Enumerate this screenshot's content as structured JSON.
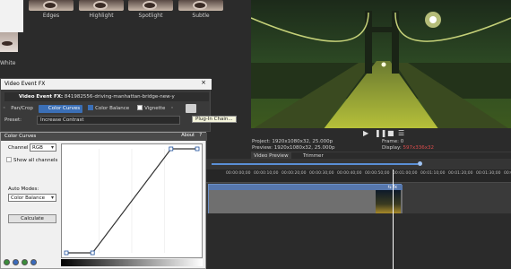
{
  "thumbnails": [
    {
      "label": "Edges"
    },
    {
      "label": "Highlight"
    },
    {
      "label": "Spotlight"
    },
    {
      "label": "Subtle"
    }
  ],
  "left_thumb_label": "White",
  "video_event_fx": {
    "title": "Video Event FX",
    "close": "×",
    "name_label": "Video Event FX:",
    "clip_name": "841982556-driving-manhattan-bridge-new-y",
    "chain": [
      {
        "label": "Pan/Crop",
        "checked": false,
        "active": false
      },
      {
        "label": "Color Curves",
        "checked": true,
        "active": true
      },
      {
        "label": "Color Balance",
        "checked": true,
        "active": false
      },
      {
        "label": "Vignette",
        "checked": false,
        "active": false
      }
    ],
    "preset_label": "Preset:",
    "preset_value": "Increase Contrast",
    "plugin_tooltip": "Plug-In Chain..."
  },
  "color_curves": {
    "title": "Color Curves",
    "about": "About",
    "help": "?",
    "channel_label": "Channel",
    "channel_value": "RGB",
    "show_all_label": "Show all channels",
    "auto_modes_label": "Auto Modes:",
    "auto_modes_value": "Color Balance",
    "calculate": "Calculate",
    "curve_points": [
      [
        0.0,
        0.0
      ],
      [
        0.2,
        0.0
      ],
      [
        0.8,
        1.0
      ],
      [
        1.0,
        1.0
      ]
    ]
  },
  "preview": {
    "properties": {
      "project_label": "Project:",
      "project_value": "1920x1080x32, 25.000p",
      "preview_label": "Preview:",
      "preview_value": "1920x1080x32, 25.000p",
      "frame_label": "Frame:",
      "frame_value": "0",
      "display_label": "Display:",
      "display_value": "597x336x32"
    },
    "tabs": [
      "Video Preview",
      "Trimmer"
    ]
  },
  "timeline": {
    "ticks": [
      "00:00:00;00",
      "00:00:10;00",
      "00:00:20;00",
      "00:00:30;00",
      "00:00:40;00",
      "00:00:50;00",
      "00:01:00;00",
      "00:01:10;00",
      "00:01:20;00",
      "00:01:30;00",
      "00:01:40;00"
    ]
  }
}
